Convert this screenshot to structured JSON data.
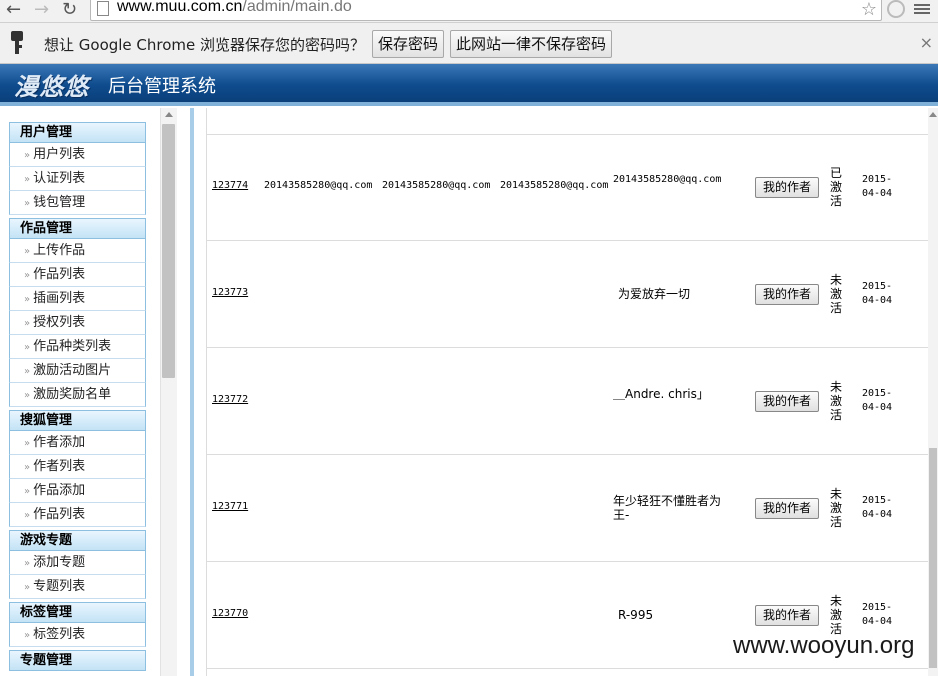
{
  "browser": {
    "url_host": "www.muu.com.cn",
    "url_path": "/admin/main.do"
  },
  "password_bar": {
    "message": "想让 Google Chrome 浏览器保存您的密码吗？",
    "save_label": "保存密码",
    "never_label": "此网站一律不保存密码",
    "close_label": "×"
  },
  "app": {
    "logo": "漫悠悠",
    "title": "后台管理系统"
  },
  "sidebar": {
    "groups": [
      {
        "title": "用户管理",
        "items": [
          "用户列表",
          "认证列表",
          "钱包管理"
        ]
      },
      {
        "title": "作品管理",
        "items": [
          "上传作品",
          "作品列表",
          "插画列表",
          "授权列表",
          "作品种类列表",
          "激励活动图片",
          "激励奖励名单"
        ]
      },
      {
        "title": "搜狐管理",
        "items": [
          "作者添加",
          "作者列表",
          "作品添加",
          "作品列表"
        ]
      },
      {
        "title": "游戏专题",
        "items": [
          "添加专题",
          "专题列表"
        ]
      },
      {
        "title": "标签管理",
        "items": [
          "标签列表"
        ]
      },
      {
        "title": "专题管理",
        "items": []
      }
    ]
  },
  "table": {
    "rows": [
      {
        "id": "123774",
        "c1": "20143585280@qq.com",
        "c2": "20143585280@qq.com",
        "c3": "20143585280@qq.com",
        "nickname": "20143585280@qq.com",
        "action": "我的作者",
        "status": "已激活",
        "date": "2015-04-04"
      },
      {
        "id": "123773",
        "c1": "",
        "c2": "",
        "c3": "",
        "nickname": "为爱放弃一切",
        "action": "我的作者",
        "status": "未激活",
        "date": "2015-04-04"
      },
      {
        "id": "123772",
        "c1": "",
        "c2": "",
        "c3": "",
        "nickname": "＿Andre. chris｣",
        "action": "我的作者",
        "status": "未激活",
        "date": "2015-04-04"
      },
      {
        "id": "123771",
        "c1": "",
        "c2": "",
        "c3": "",
        "nickname": " 年少轻狂不懂胜者为王-",
        "action": "我的作者",
        "status": "未激活",
        "date": "2015-04-04"
      },
      {
        "id": "123770",
        "c1": "",
        "c2": "",
        "c3": "",
        "nickname": "R-995",
        "action": "我的作者",
        "status": "未激活",
        "date": "2015-04-04"
      }
    ]
  },
  "watermark": "www.wooyun.org"
}
